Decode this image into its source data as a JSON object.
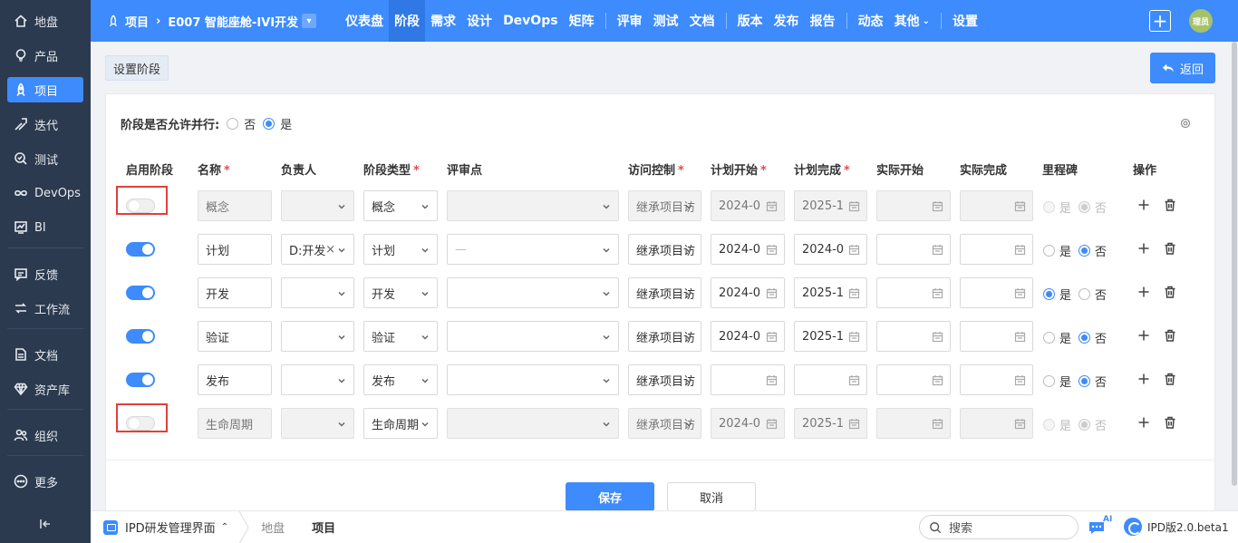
{
  "sidebar": {
    "items": [
      {
        "label": "地盘",
        "icon": "home-icon"
      },
      {
        "label": "产品",
        "icon": "bulb-icon"
      },
      {
        "label": "项目",
        "icon": "rocket-icon",
        "active": true
      },
      {
        "label": "迭代",
        "icon": "sprint-icon"
      },
      {
        "label": "测试",
        "icon": "test-icon"
      },
      {
        "label": "DevOps",
        "icon": "infinity-icon"
      },
      {
        "label": "BI",
        "icon": "chart-icon"
      },
      {
        "label": "反馈",
        "icon": "feedback-icon"
      },
      {
        "label": "工作流",
        "icon": "workflow-icon"
      },
      {
        "label": "文档",
        "icon": "doc-icon"
      },
      {
        "label": "资产库",
        "icon": "diamond-icon"
      },
      {
        "label": "组织",
        "icon": "org-icon"
      },
      {
        "label": "更多",
        "icon": "more-icon"
      }
    ]
  },
  "topbar": {
    "crumb_root": "项目",
    "crumb_project": "E007 智能座舱-IVI开发",
    "nav": [
      "仪表盘",
      "阶段",
      "需求",
      "设计",
      "DevOps",
      "矩阵",
      "评审",
      "测试",
      "文档",
      "版本",
      "发布",
      "报告",
      "动态",
      "其他",
      "设置"
    ],
    "active_nav": "阶段",
    "avatar_text": "理员"
  },
  "header": {
    "title": "设置阶段",
    "back_label": "返回"
  },
  "parallel": {
    "label": "阶段是否允许并行:",
    "no": "否",
    "yes": "是",
    "selected": "是"
  },
  "columns": {
    "enable": "启用阶段",
    "name": "名称",
    "owner": "负责人",
    "type": "阶段类型",
    "review": "评审点",
    "access": "访问控制",
    "plan_start": "计划开始",
    "plan_end": "计划完成",
    "actual_start": "实际开始",
    "actual_end": "实际完成",
    "milestone": "里程碑",
    "ops": "操作"
  },
  "rows": [
    {
      "enabled": false,
      "name": "概念",
      "owner": "",
      "type": "概念",
      "review": "",
      "access": "继承项目访",
      "plan_start": "2024-0",
      "plan_end": "2025-1",
      "actual_start": "",
      "actual_end": "",
      "milestone": "否",
      "disabled": true
    },
    {
      "enabled": true,
      "name": "计划",
      "owner": "D:开发",
      "type": "计划",
      "review": "—",
      "access": "继承项目访",
      "plan_start": "2024-0",
      "plan_end": "2024-0",
      "actual_start": "",
      "actual_end": "",
      "milestone": "否",
      "disabled": false
    },
    {
      "enabled": true,
      "name": "开发",
      "owner": "",
      "type": "开发",
      "review": "",
      "access": "继承项目访",
      "plan_start": "2024-0",
      "plan_end": "2025-1",
      "actual_start": "",
      "actual_end": "",
      "milestone": "是",
      "disabled": false
    },
    {
      "enabled": true,
      "name": "验证",
      "owner": "",
      "type": "验证",
      "review": "",
      "access": "继承项目访",
      "plan_start": "2024-0",
      "plan_end": "2025-1",
      "actual_start": "",
      "actual_end": "",
      "milestone": "否",
      "disabled": false
    },
    {
      "enabled": true,
      "name": "发布",
      "owner": "",
      "type": "发布",
      "review": "",
      "access": "继承项目访",
      "plan_start": "",
      "plan_end": "",
      "actual_start": "",
      "actual_end": "",
      "milestone": "否",
      "disabled": false
    },
    {
      "enabled": false,
      "name": "生命周期",
      "owner": "",
      "type": "生命周期",
      "review": "",
      "access": "继承项目访",
      "plan_start": "2024-0",
      "plan_end": "2025-1",
      "actual_start": "",
      "actual_end": "",
      "milestone": "否",
      "disabled": true
    }
  ],
  "milestone_yes": "是",
  "milestone_no": "否",
  "footer": {
    "save_label": "保存",
    "cancel_label": "取消"
  },
  "bottombar": {
    "app_name": "IPD研发管理界面",
    "tab_home": "地盘",
    "tab_current": "项目",
    "search_placeholder": "搜索",
    "ai_badge": "AI",
    "version": "IPD版2.0.beta1"
  },
  "colors": {
    "primary": "#3d8bfd",
    "sidebar": "#2b3a4e",
    "required": "#e34d4d",
    "highlight": "#e0403a"
  }
}
